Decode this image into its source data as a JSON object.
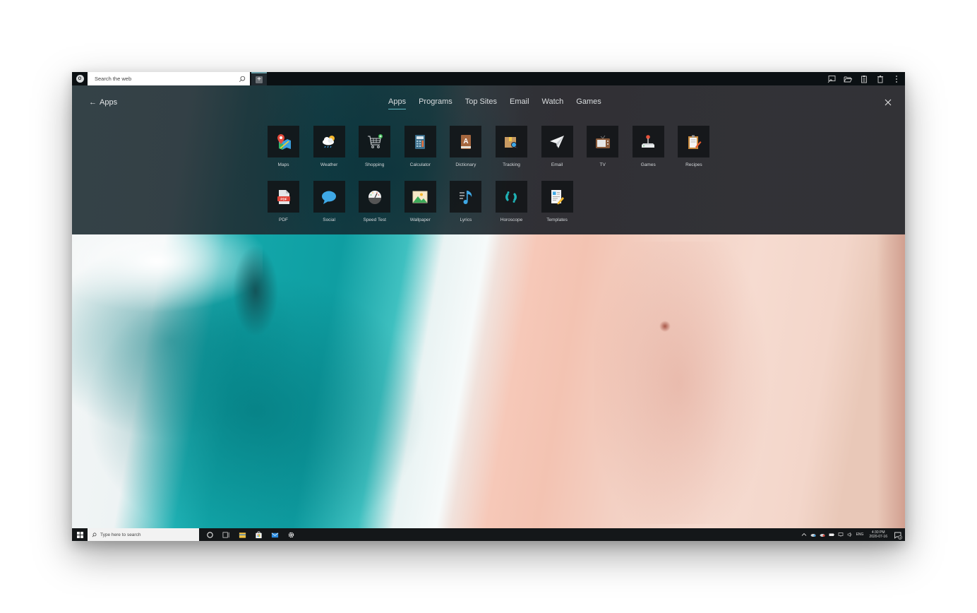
{
  "browser": {
    "search_placeholder": "Search the web",
    "logo_letter": "O",
    "new_tab_label": "+",
    "toolbar_icons": [
      "screenshot-icon",
      "folder-open-icon",
      "clipboard-icon",
      "trash-icon",
      "more-vertical-icon"
    ]
  },
  "panel": {
    "back_label": "Apps",
    "tabs": [
      {
        "label": "Apps",
        "active": true
      },
      {
        "label": "Programs",
        "active": false
      },
      {
        "label": "Top Sites",
        "active": false
      },
      {
        "label": "Email",
        "active": false
      },
      {
        "label": "Watch",
        "active": false
      },
      {
        "label": "Games",
        "active": false
      }
    ],
    "accent_color": "#5fb8c2",
    "apps_row1": [
      {
        "label": "Maps",
        "icon": "maps-icon"
      },
      {
        "label": "Weather",
        "icon": "weather-icon"
      },
      {
        "label": "Shopping",
        "icon": "shopping-cart-icon"
      },
      {
        "label": "Calculator",
        "icon": "calculator-icon"
      },
      {
        "label": "Dictionary",
        "icon": "dictionary-icon"
      },
      {
        "label": "Tracking",
        "icon": "package-tracking-icon"
      },
      {
        "label": "Email",
        "icon": "paper-plane-icon"
      },
      {
        "label": "TV",
        "icon": "tv-icon"
      },
      {
        "label": "Games",
        "icon": "joystick-icon"
      },
      {
        "label": "Recipes",
        "icon": "recipe-clipboard-icon"
      }
    ],
    "apps_row2": [
      {
        "label": "PDF",
        "icon": "pdf-icon"
      },
      {
        "label": "Social",
        "icon": "chat-bubble-icon"
      },
      {
        "label": "Speed Test",
        "icon": "speedometer-icon"
      },
      {
        "label": "Wallpaper",
        "icon": "image-icon"
      },
      {
        "label": "Lyrics",
        "icon": "music-note-icon"
      },
      {
        "label": "Horoscope",
        "icon": "pisces-icon"
      },
      {
        "label": "Templates",
        "icon": "template-doc-icon"
      }
    ]
  },
  "taskbar": {
    "search_placeholder": "Type here to search",
    "pinned": [
      "cortana-icon",
      "task-view-icon",
      "file-explorer-icon",
      "store-icon",
      "mail-icon",
      "settings-icon"
    ],
    "tray": {
      "language": "ENG",
      "time": "4:30 PM",
      "date": "2020-07-16",
      "notification_count": "3"
    }
  }
}
